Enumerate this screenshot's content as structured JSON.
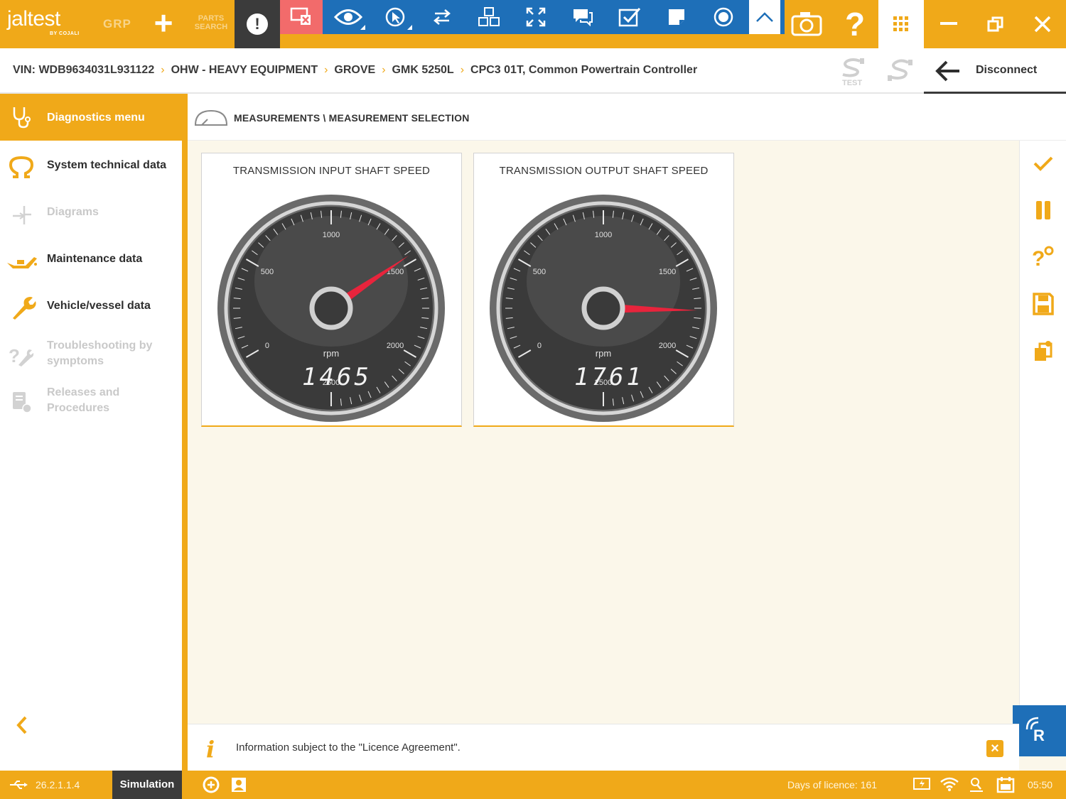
{
  "topbar": {
    "logo_text": "jaltest",
    "logo_sub": "BY COJALI",
    "grp_label": "GRP",
    "parts_label": "PARTS SEARCH",
    "colors": {
      "brand": "#f0a919",
      "remote_bar": "#1e6fb8",
      "dark": "#3b3b3b"
    }
  },
  "breadcrumb": {
    "items": [
      "VIN: WDB9634031L931122",
      "OHW - HEAVY EQUIPMENT",
      "GROVE",
      "GMK 5250L",
      "CPC3 01T, Common Powertrain Controller"
    ],
    "separator": "›",
    "test_label": "TEST",
    "disconnect_label": "Disconnect"
  },
  "sidebar": {
    "header": "Diagnostics menu",
    "items": [
      {
        "label": "System technical data",
        "icon": "omega-icon",
        "enabled": true
      },
      {
        "label": "Diagrams",
        "icon": "diagram-icon",
        "enabled": false
      },
      {
        "label": "Maintenance data",
        "icon": "oil-can-icon",
        "enabled": true
      },
      {
        "label": "Vehicle/vessel data",
        "icon": "wrench-icon",
        "enabled": true
      },
      {
        "label": "Troubleshooting by symptoms",
        "icon": "troubleshoot-icon",
        "enabled": false
      },
      {
        "label": "Releases and Procedures",
        "icon": "procedures-icon",
        "enabled": false
      }
    ]
  },
  "content": {
    "title": "MEASUREMENTS \\ MEASUREMENT SELECTION",
    "gauges": [
      {
        "title": "TRANSMISSION INPUT SHAFT SPEED",
        "unit": "rpm",
        "display": "1465",
        "value": 1465,
        "min": 0,
        "max": 2500,
        "ticks": [
          "0",
          "500",
          "1000",
          "1500",
          "2000",
          "2500"
        ]
      },
      {
        "title": "TRANSMISSION OUTPUT SHAFT SPEED",
        "unit": "rpm",
        "display": "1761",
        "value": 1761,
        "min": 0,
        "max": 2500,
        "ticks": [
          "0",
          "500",
          "1000",
          "1500",
          "2000",
          "2500"
        ]
      }
    ],
    "info_message": "Information subject to the \"Licence Agreement\".",
    "remote_label": "R"
  },
  "statusbar": {
    "version": "26.2.1.1.4",
    "mode": "Simulation",
    "licence": "Days of licence: 161",
    "time": "05:50"
  }
}
